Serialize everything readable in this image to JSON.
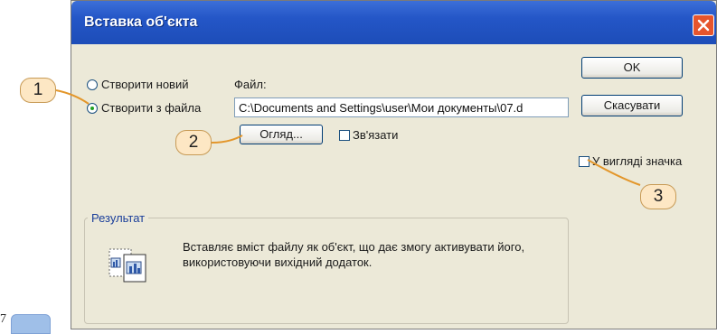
{
  "page": {
    "number": "7"
  },
  "dialog": {
    "title": "Вставка об'єкта",
    "close_icon": "close-icon",
    "radio_create_new_label": "Створити новий",
    "radio_from_file_label": "Створити з файла",
    "file_label": "Файл:",
    "file_path_value": "C:\\Documents and Settings\\user\\Мои документы\\07.d",
    "browse_button_label": "Огляд...",
    "link_checkbox_label": "Зв'язати",
    "ok_button_label": "OK",
    "cancel_button_label": "Скасувати",
    "as_icon_checkbox_label": "У вигляді значка",
    "result_group_title": "Результат",
    "result_text": "Вставляє вміст файлу як об'єкт, що дає змогу активувати його, використовуючи вихідний додаток."
  },
  "callouts": [
    "1",
    "2",
    "3"
  ],
  "colors": {
    "titlebar": "#2456c7",
    "dialog_bg": "#ece9d8",
    "callout_fill": "#fde7c4",
    "callout_line": "#e3962a"
  }
}
